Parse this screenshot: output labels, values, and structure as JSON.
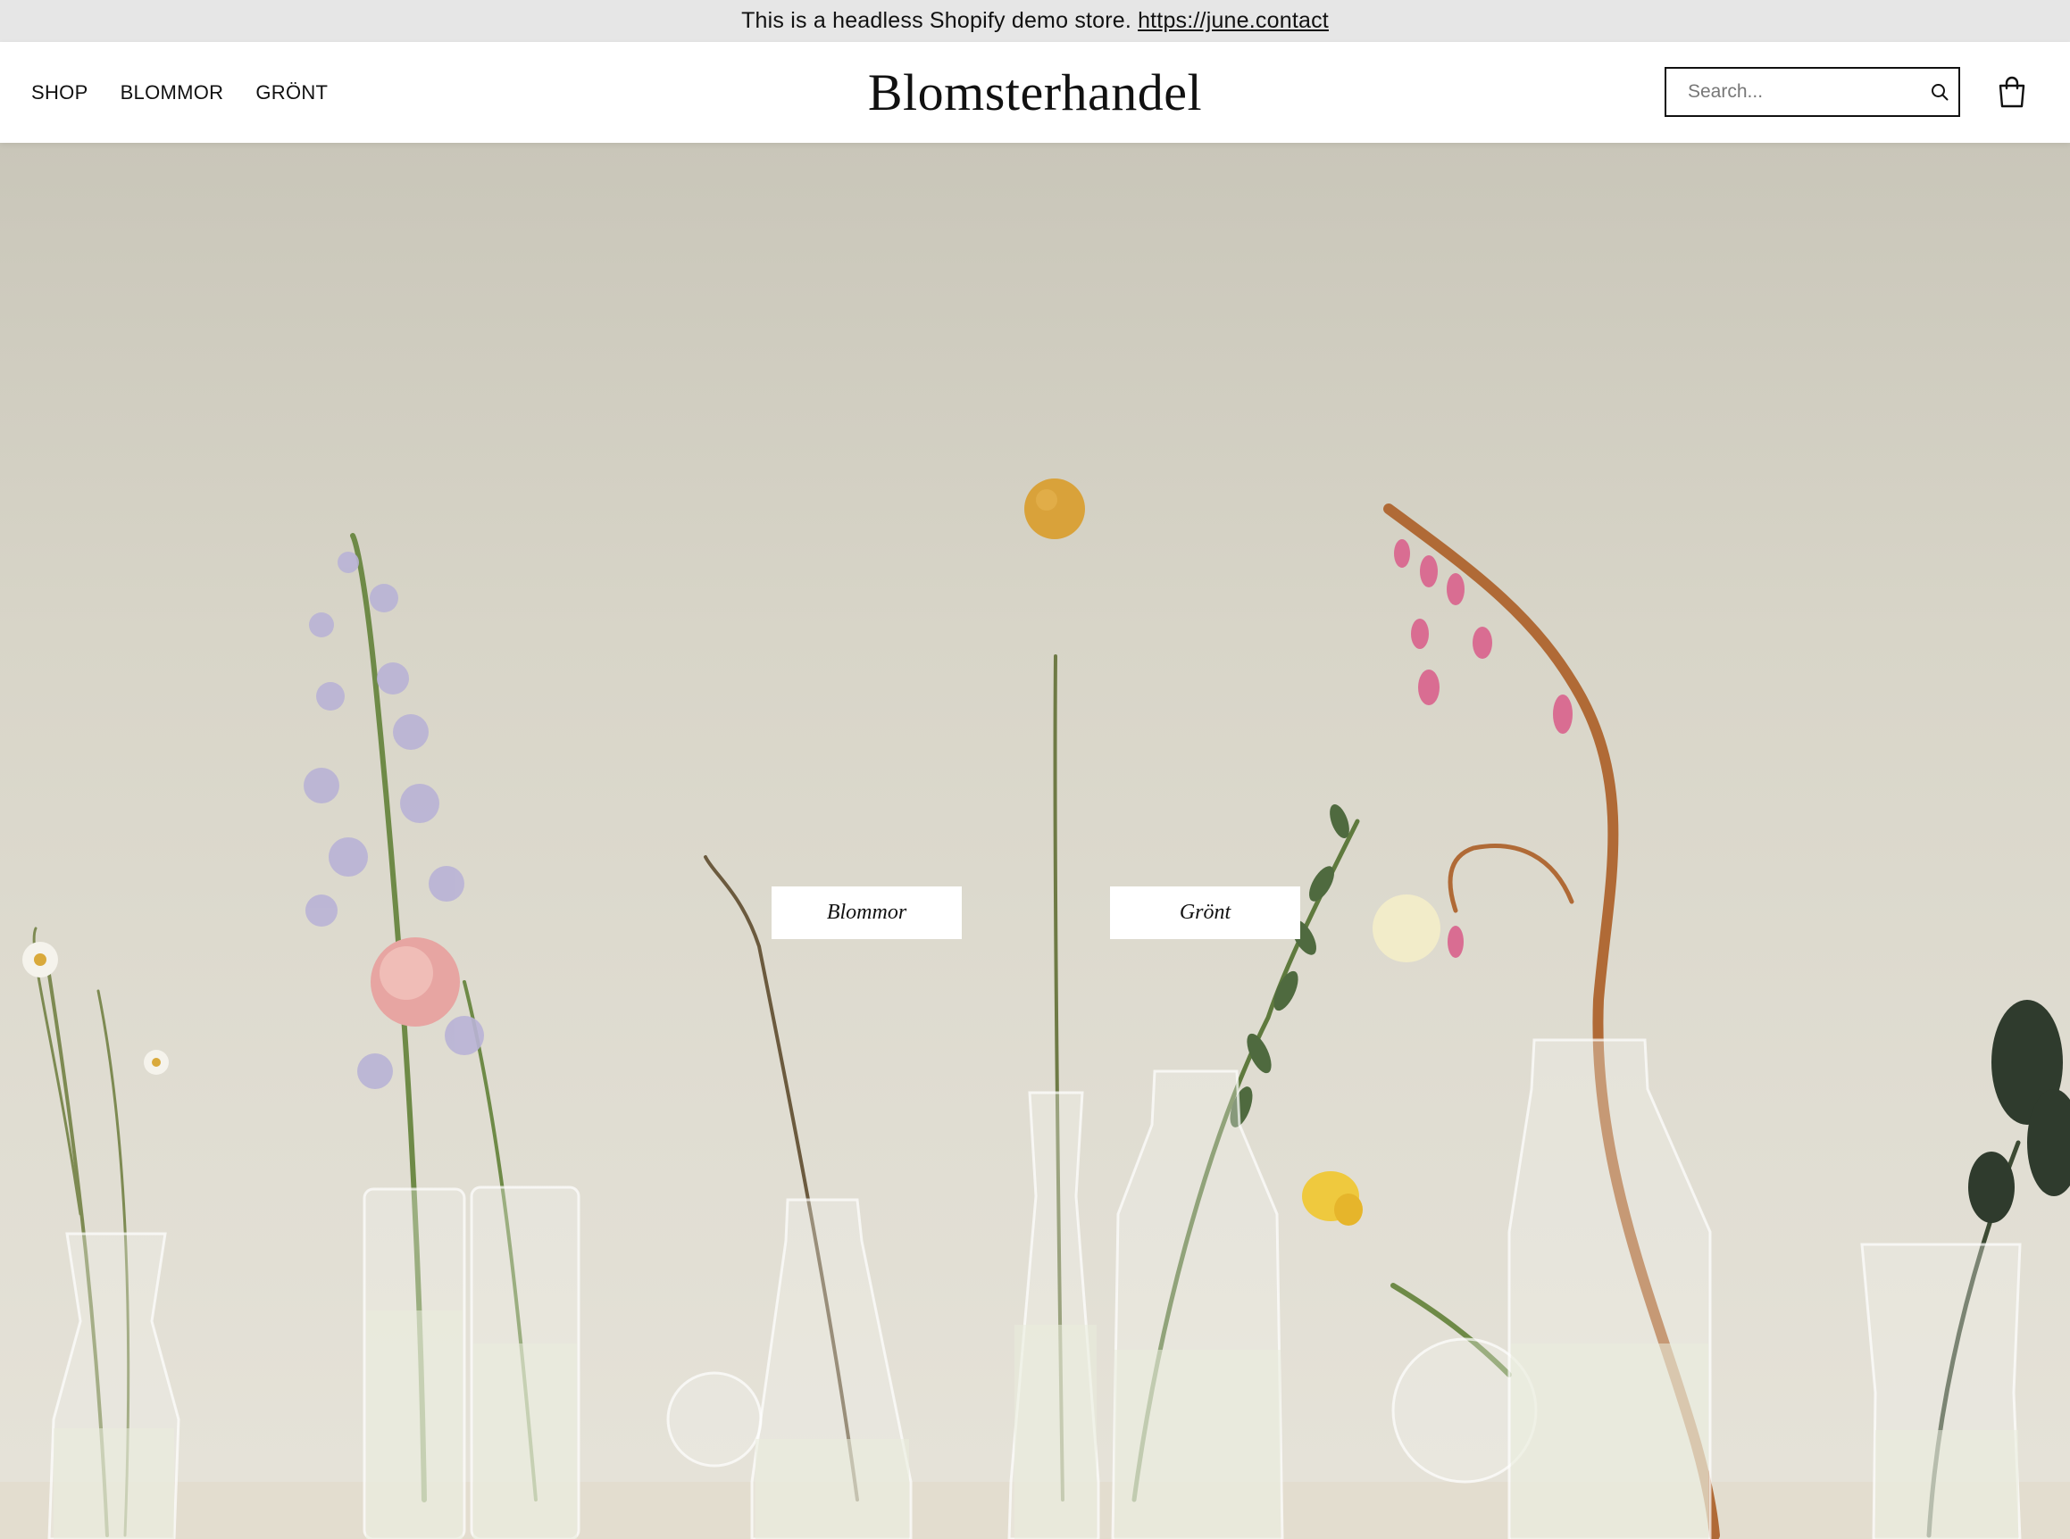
{
  "announcement": {
    "text": "This is a headless Shopify demo store.",
    "link": "https://june.contact"
  },
  "nav": {
    "items": [
      {
        "label": "SHOP"
      },
      {
        "label": "BLOMMOR"
      },
      {
        "label": "GRÖNT"
      }
    ]
  },
  "brand": {
    "name": "Blomsterhandel"
  },
  "search": {
    "placeholder": "Search..."
  },
  "icons": {
    "search": "search-icon",
    "cart": "shopping-bag-icon"
  },
  "hero": {
    "buttons": [
      {
        "label": "Blommor"
      },
      {
        "label": "Grönt"
      }
    ]
  },
  "colors": {
    "announcement_bg": "#e6e6e6",
    "header_bg": "#ffffff",
    "hero_bg": "#dcd9cd",
    "text": "#111111"
  }
}
